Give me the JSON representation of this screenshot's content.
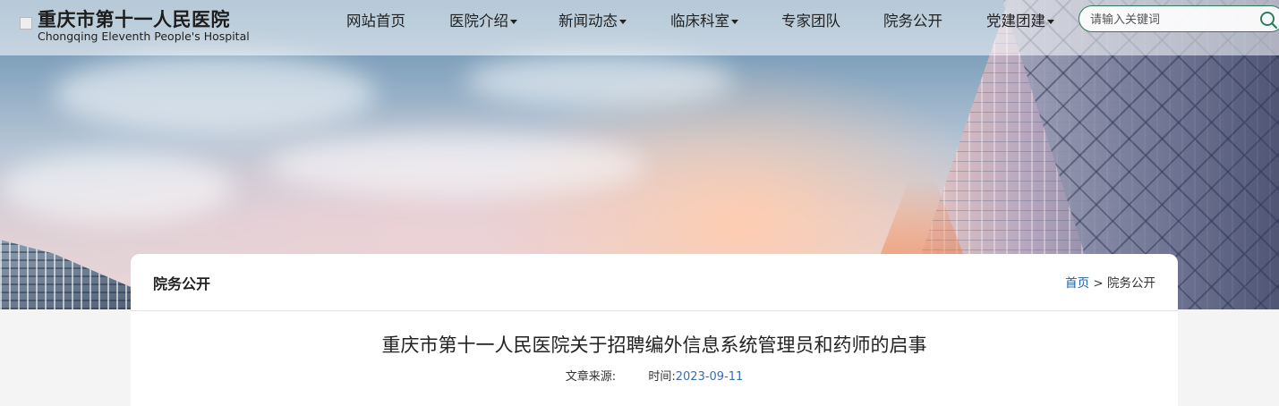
{
  "site": {
    "name_cn": "重庆市第十一人民医院",
    "name_en": "Chongqing Eleventh People's Hospital"
  },
  "nav": {
    "items": [
      {
        "label": "网站首页",
        "dropdown": false
      },
      {
        "label": "医院介绍",
        "dropdown": true
      },
      {
        "label": "新闻动态",
        "dropdown": true
      },
      {
        "label": "临床科室",
        "dropdown": true
      },
      {
        "label": "专家团队",
        "dropdown": false
      },
      {
        "label": "院务公开",
        "dropdown": false
      },
      {
        "label": "党建团建",
        "dropdown": true
      }
    ]
  },
  "search": {
    "placeholder": "请输入关键词",
    "icon": "search-icon"
  },
  "section": {
    "title": "院务公开",
    "breadcrumb_home": "首页",
    "breadcrumb_sep": ">",
    "breadcrumb_current": "院务公开"
  },
  "article": {
    "title": "重庆市第十一人民医院关于招聘编外信息系统管理员和药师的启事",
    "source_label": "文章来源:",
    "time_label": "时间:",
    "date": "2023-09-11"
  },
  "colors": {
    "accent": "#2f7d5b",
    "link": "#1f5fa0",
    "date": "#3a6db0"
  }
}
